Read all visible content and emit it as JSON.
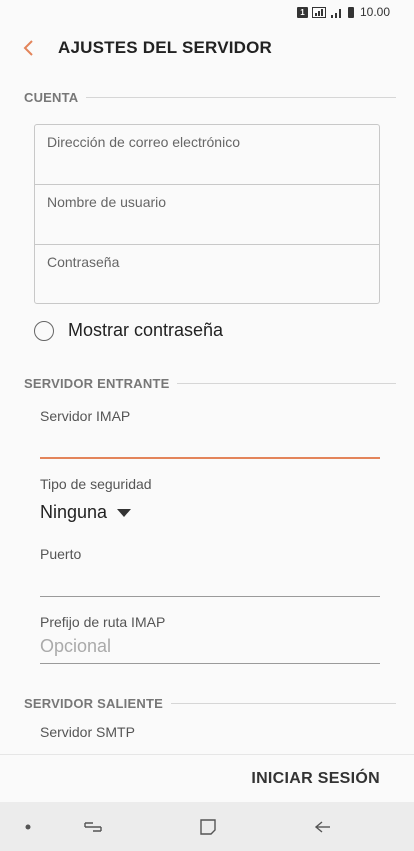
{
  "status_bar": {
    "sim_label": "1",
    "time": "10.00"
  },
  "app_bar": {
    "title": "AJUSTES DEL SERVIDOR"
  },
  "account": {
    "header": "CUENTA",
    "email_placeholder": "Dirección de correo electrónico",
    "username_placeholder": "Nombre de usuario",
    "password_placeholder": "Contraseña",
    "show_password_label": "Mostrar contraseña"
  },
  "incoming": {
    "header": "SERVIDOR ENTRANTE",
    "imap_label": "Servidor IMAP",
    "security_label": "Tipo de seguridad",
    "security_value": "Ninguna",
    "port_label": "Puerto",
    "prefix_label": "Prefijo de ruta IMAP",
    "prefix_placeholder": "Opcional"
  },
  "outgoing": {
    "header": "SERVIDOR SALIENTE",
    "smtp_label": "Servidor SMTP"
  },
  "footer": {
    "login_label": "INICIAR SESIÓN"
  },
  "colors": {
    "accent": "#e3845a",
    "background": "#fafafa",
    "navbar": "#ececec"
  }
}
